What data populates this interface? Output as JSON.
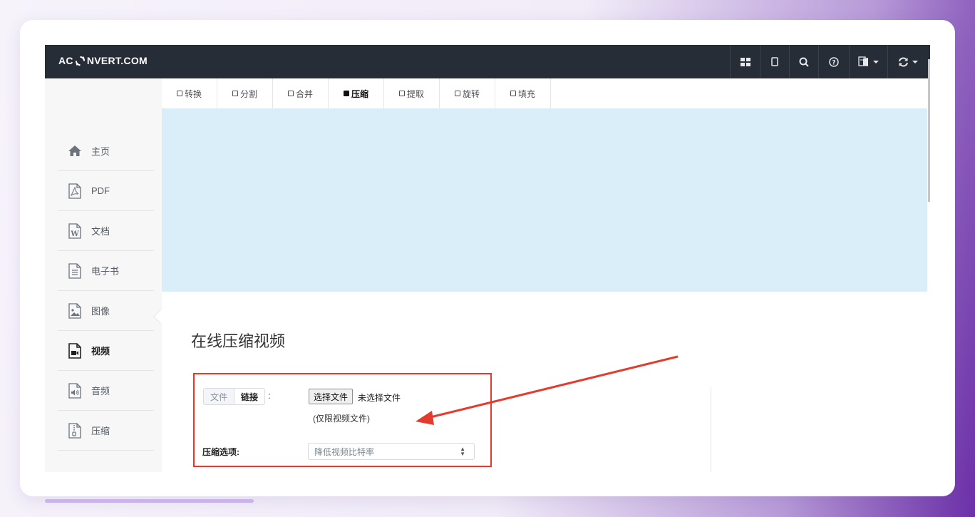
{
  "brand": {
    "prefix": "AC",
    "suffix": "NVERT.COM"
  },
  "navbar": {
    "buttons": [
      "grid-icon",
      "tablet-icon",
      "search-icon",
      "help-icon",
      "language-icon",
      "sync-icon"
    ]
  },
  "tabs": [
    {
      "label": "转换",
      "active": false
    },
    {
      "label": "分割",
      "active": false
    },
    {
      "label": "合并",
      "active": false
    },
    {
      "label": "压缩",
      "active": true
    },
    {
      "label": "提取",
      "active": false
    },
    {
      "label": "旋转",
      "active": false
    },
    {
      "label": "填充",
      "active": false
    }
  ],
  "sidebar": {
    "items": [
      {
        "label": "主页",
        "icon": "home-icon"
      },
      {
        "label": "PDF",
        "icon": "pdf-file-icon"
      },
      {
        "label": "文档",
        "icon": "word-file-icon"
      },
      {
        "label": "电子书",
        "icon": "ebook-file-icon"
      },
      {
        "label": "图像",
        "icon": "image-file-icon"
      },
      {
        "label": "视频",
        "icon": "video-file-icon",
        "active": true
      },
      {
        "label": "音频",
        "icon": "audio-file-icon"
      },
      {
        "label": "压缩",
        "icon": "archive-file-icon"
      }
    ]
  },
  "main": {
    "title": "在线压缩视频",
    "source_tabs": {
      "file": "文件",
      "link": "链接"
    },
    "colon": ":",
    "file_button": "选择文件",
    "file_status": "未选择文件",
    "hint": "(仅限视频文件)",
    "options_label": "压缩选项:",
    "options_selected": "降低视频比特率"
  },
  "colors": {
    "navbar": "#272d36",
    "banner": "#d9eef9",
    "highlight": "#e33b2e"
  }
}
